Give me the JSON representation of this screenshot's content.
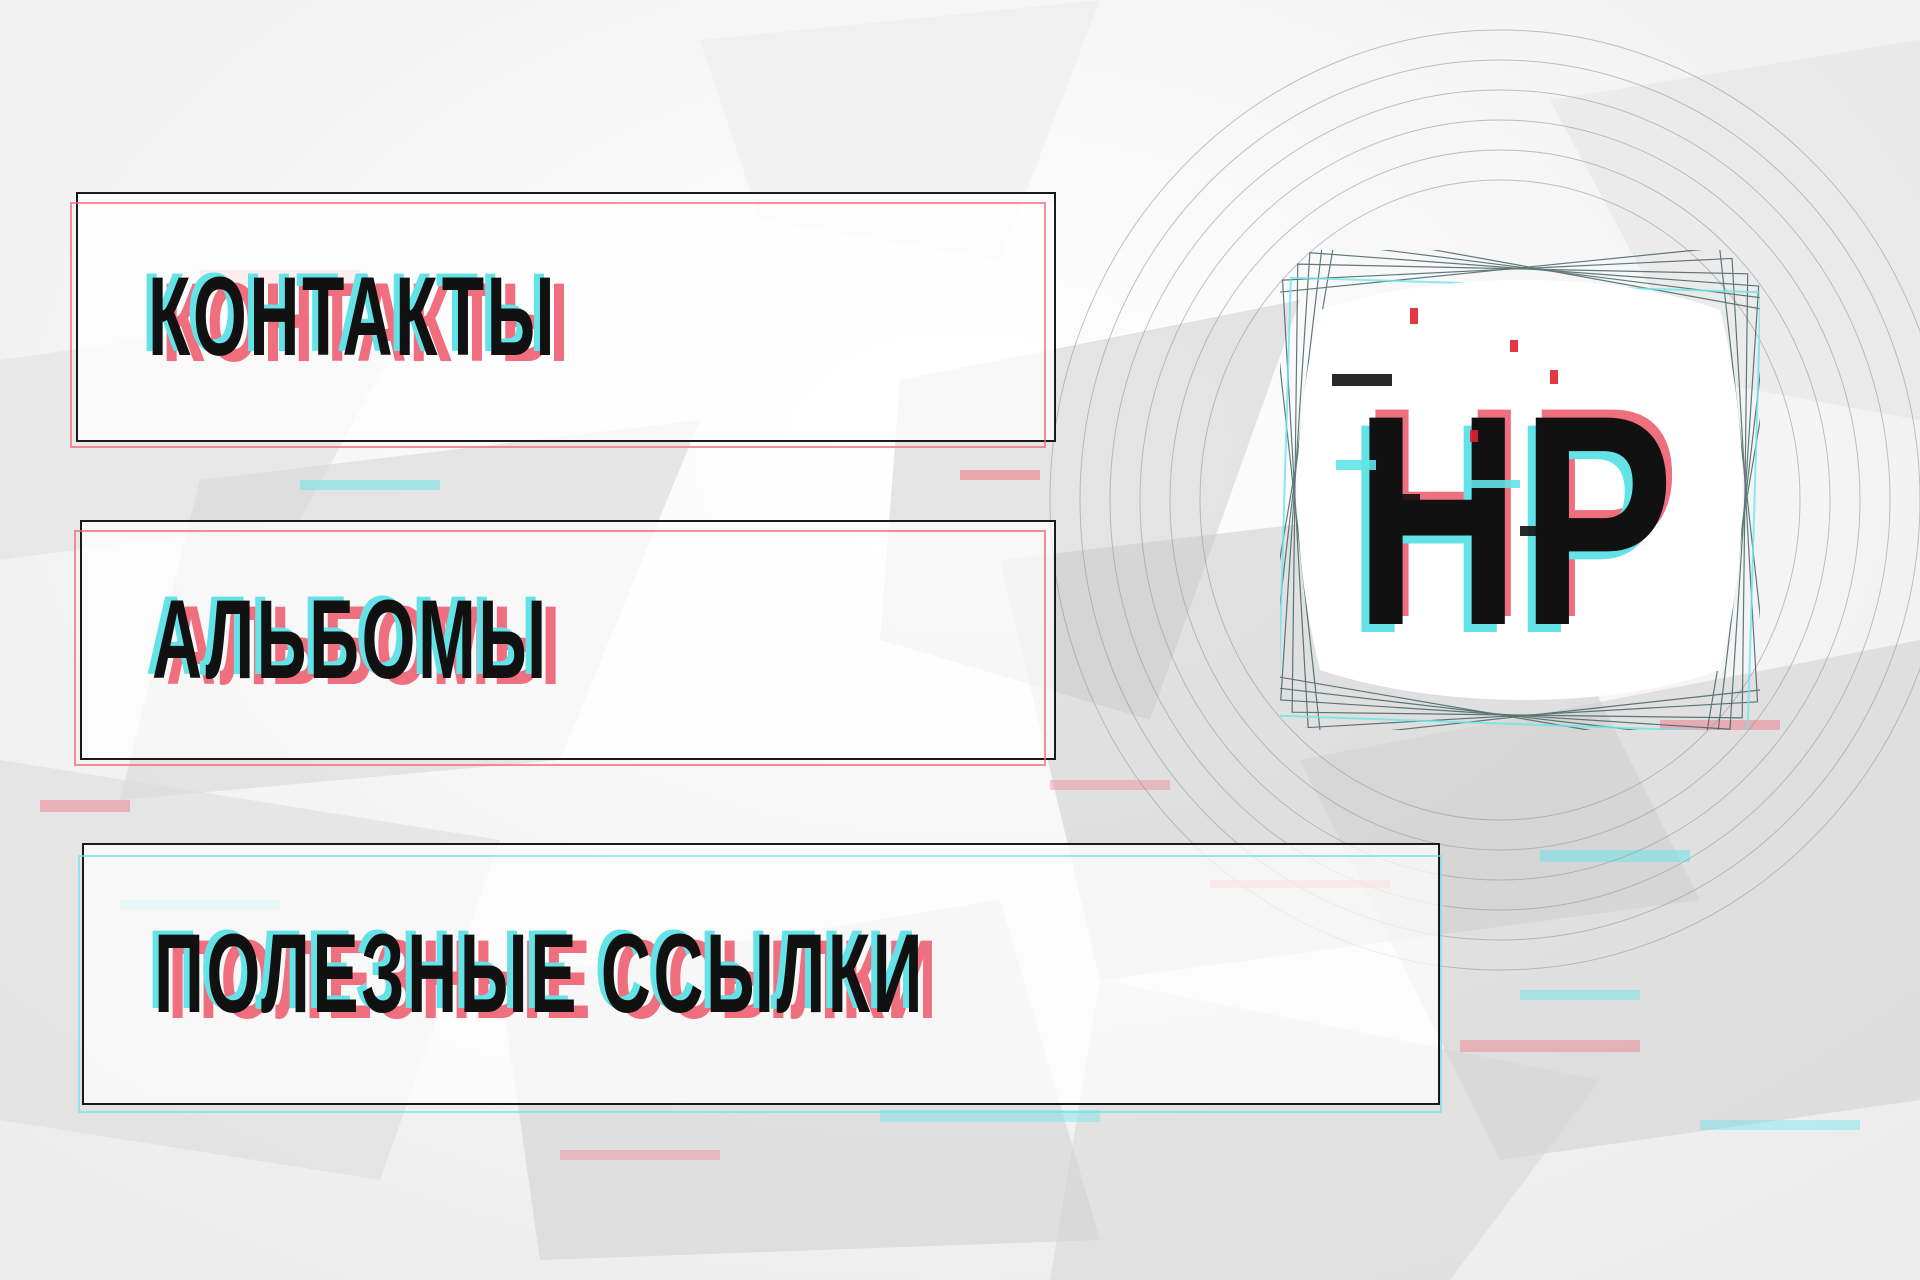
{
  "menu": {
    "items": [
      {
        "label": "КОНТАКТЫ"
      },
      {
        "label": "АЛЬБОМЫ"
      },
      {
        "label": "ПОЛЕЗНЫЕ ССЫЛКИ"
      }
    ]
  },
  "logo": {
    "text": "HP"
  },
  "colors": {
    "accent_red": "#ef6f7e",
    "accent_cyan": "#63e3e8",
    "text": "#111111",
    "background": "#f4f4f4"
  }
}
